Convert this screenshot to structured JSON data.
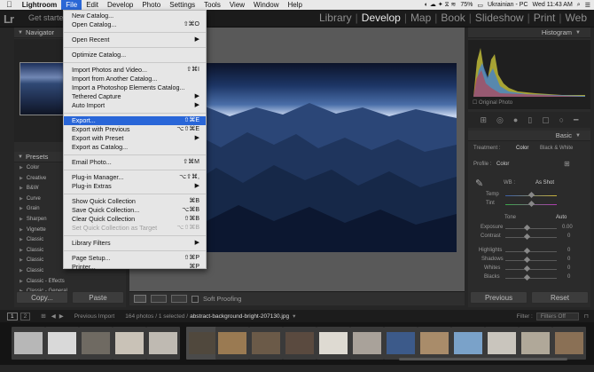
{
  "menubar": {
    "apple": "",
    "items": [
      "Lightroom",
      "File",
      "Edit",
      "Develop",
      "Photo",
      "Settings",
      "Tools",
      "View",
      "Window",
      "Help"
    ],
    "active": "File",
    "battery": "75%",
    "language": "Ukrainian - PC",
    "clock": "Wed 11:43 AM"
  },
  "lr": {
    "logo": "Lr",
    "title": "Get starte",
    "modules": [
      "Library",
      "Develop",
      "Map",
      "Book",
      "Slideshow",
      "Print",
      "Web"
    ],
    "active_module": "Develop"
  },
  "left_panel": {
    "navigator": "Navigator",
    "presets": "Presets",
    "preset_items": [
      "Color",
      "Creative",
      "B&W",
      "Curve",
      "Grain",
      "Sharpen",
      "Vignette",
      "Classic",
      "Classic",
      "Classic",
      "Classic",
      "Classic - Effects",
      "Classic - General"
    ],
    "copy": "Copy...",
    "paste": "Paste"
  },
  "toolbar": {
    "soft_proofing": "Soft Proofing"
  },
  "right_panel": {
    "histogram": "Histogram",
    "original_photo": "Original Photo",
    "basic": "Basic",
    "treatment_label": "Treatment :",
    "treatment_color": "Color",
    "treatment_bw": "Black & White",
    "profile_label": "Profile :",
    "profile_value": "Color",
    "wb_label": "WB :",
    "wb_value": "As Shot",
    "temp": "Temp",
    "tint": "Tint",
    "tone": "Tone",
    "auto": "Auto",
    "exposure": "Exposure",
    "exposure_val": "0.00",
    "contrast": "Contrast",
    "contrast_val": "0",
    "highlights": "Highlights",
    "highlights_val": "0",
    "shadows": "Shadows",
    "shadows_val": "0",
    "whites": "Whites",
    "whites_val": "0",
    "blacks": "Blacks",
    "blacks_val": "0",
    "previous": "Previous",
    "reset": "Reset"
  },
  "filmstrip_bar": {
    "page1": "1",
    "page2": "2",
    "source": "Previous Import",
    "info": "164 photos / 1 selected /",
    "filename": "abstract-background-bright-207130.jpg",
    "filter_label": "Filter :",
    "filter_value": "Filters Off"
  },
  "file_menu": [
    {
      "label": "New Catalog...",
      "shortcut": ""
    },
    {
      "label": "Open Catalog...",
      "shortcut": "⇧⌘O"
    },
    {
      "sep": true
    },
    {
      "label": "Open Recent",
      "shortcut": "▶"
    },
    {
      "sep": true
    },
    {
      "label": "Optimize Catalog...",
      "shortcut": ""
    },
    {
      "sep": true
    },
    {
      "label": "Import Photos and Video...",
      "shortcut": "⇧⌘I"
    },
    {
      "label": "Import from Another Catalog...",
      "shortcut": ""
    },
    {
      "label": "Import a Photoshop Elements Catalog...",
      "shortcut": ""
    },
    {
      "label": "Tethered Capture",
      "shortcut": "▶"
    },
    {
      "label": "Auto Import",
      "shortcut": "▶"
    },
    {
      "sep": true
    },
    {
      "label": "Export...",
      "shortcut": "⇧⌘E",
      "highlight": true
    },
    {
      "label": "Export with Previous",
      "shortcut": "⌥⇧⌘E"
    },
    {
      "label": "Export with Preset",
      "shortcut": "▶"
    },
    {
      "label": "Export as Catalog...",
      "shortcut": ""
    },
    {
      "sep": true
    },
    {
      "label": "Email Photo...",
      "shortcut": "⇧⌘M"
    },
    {
      "sep": true
    },
    {
      "label": "Plug-in Manager...",
      "shortcut": "⌥⇧⌘,"
    },
    {
      "label": "Plug-in Extras",
      "shortcut": "▶"
    },
    {
      "sep": true
    },
    {
      "label": "Show Quick Collection",
      "shortcut": "⌘B"
    },
    {
      "label": "Save Quick Collection...",
      "shortcut": "⌥⌘B"
    },
    {
      "label": "Clear Quick Collection",
      "shortcut": "⇧⌘B"
    },
    {
      "label": "Set Quick Collection as Target",
      "shortcut": "⌥⇧⌘B",
      "disabled": true
    },
    {
      "sep": true
    },
    {
      "label": "Library Filters",
      "shortcut": "▶"
    },
    {
      "sep": true
    },
    {
      "label": "Page Setup...",
      "shortcut": "⇧⌘P"
    },
    {
      "label": "Printer...",
      "shortcut": "⌘P"
    }
  ],
  "colors": {
    "menu_highlight": "#2966d8",
    "panel": "#2b2b2b",
    "active_module": "#e8e8e8"
  }
}
